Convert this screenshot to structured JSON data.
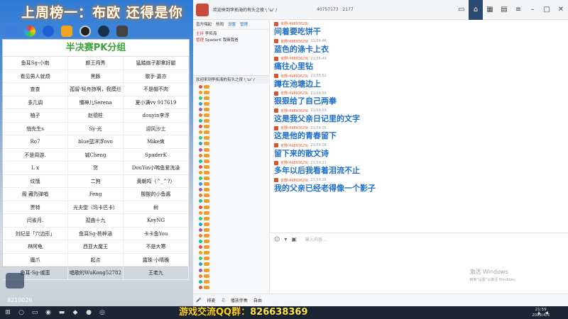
{
  "banner": "上周榜一：布欧 还得是你",
  "bracket": {
    "title": "半决赛PK分组",
    "rows": [
      [
        "鱼耳Sg-小南",
        "颜王闯秀",
        "猛踏扇子那拿好腿"
      ],
      [
        "看见男人就烦",
        "黑豚",
        "歌手-嘉亦"
      ],
      [
        "查查",
        "孤留-轻舟掠啊，我摸烂",
        "不是帽不肉"
      ],
      [
        "多几调",
        "懵神儿Serena",
        "夏小满vv 917619"
      ],
      [
        "柚子",
        "赵德柱",
        "douyin李浮"
      ],
      [
        "悄先生s",
        "Sy-光",
        "迎风沙土"
      ],
      [
        "Ro7",
        "blue蓝洋浮ovo",
        "Mike爽"
      ],
      [
        "不是周游.",
        "铖Cheng",
        "SpaderK"
      ],
      [
        "L x",
        "贷",
        "DouYin小鸭鱼爱洗澡"
      ],
      [
        "纹饿",
        "二狗",
        "黄朝鸡（^_^?）"
      ],
      [
        "阁 藏烈弹唱",
        "Feng",
        "酸酸的小鱼酱"
      ],
      [
        "贾特",
        "光夫堂（玛卡巴卡）",
        "树"
      ],
      [
        "闫雀月.",
        "孤曲十九",
        "KeyNG"
      ],
      [
        "刘纪呈「穴边形」",
        "鱼耳Sg-杨梓涵",
        "卡卡鱼You"
      ],
      [
        "林阿龟",
        "西亚大魔王",
        "不是大寒"
      ],
      [
        "魔爪",
        "起点",
        "露珠-小晴晚"
      ],
      [
        "鱼耳-Sg-戚蛮",
        "唱歌的WuKong52782",
        "王老九"
      ]
    ]
  },
  "watermark": "8210026",
  "app": {
    "room_title": "欢迎来到李拓海的有头之夜 \\ 'ω' /",
    "stat1": "40757173",
    "stat2": "2177",
    "left": {
      "tabs": [
        "直升嗨起",
        "热闹",
        "设置",
        "管理"
      ],
      "manager_label": "管理",
      "manager_name": "SpaderK 我嘛我爸",
      "host_label": "主持",
      "host_name": "李拓海",
      "room_tab": "欢迎来到李拓海的有头之夜 \\ 'ω' /"
    },
    "messages": [
      {
        "nick": "雀野(49893629)",
        "time": "",
        "text": "间着要吃饼干"
      },
      {
        "nick": "雀野(49893629)",
        "time": "21:58:46",
        "text": "蓝色的涤卡上衣"
      },
      {
        "nick": "雀野(49893629)",
        "time": "21:58:49",
        "text": "痛往心里钻"
      },
      {
        "nick": "雀野(49893629)",
        "time": "21:58:52",
        "text": "蹲在池塘边上"
      },
      {
        "nick": "雀野(49893629)",
        "time": "21:58:56",
        "text": "狠狠给了自己两拳"
      },
      {
        "nick": "雀野(49893629)",
        "time": "21:58:59",
        "text": "这是我父亲日记里的文字"
      },
      {
        "nick": "雀野(49893629)",
        "time": "21:59:05",
        "text": "这是他的青春留下"
      },
      {
        "nick": "雀野(49893629)",
        "time": "21:59:08",
        "text": "留下来的散文诗"
      },
      {
        "nick": "雀野(49893629)",
        "time": "21:59:11",
        "text": "多年以后我看着泪流不止"
      },
      {
        "nick": "雀野(49893629)",
        "time": "21:59:18",
        "text": "我的父亲已经老得像一个影子"
      }
    ],
    "composer_placeholder": "输入内容...",
    "activate_title": "激活 Windows",
    "activate_sub": "转到\"设置\"以激活 Windows。",
    "bottom": [
      "排麦",
      "播放伴奏",
      "自由"
    ]
  },
  "taskbar": {
    "qq_label": "游戏交流QQ群：",
    "qq_number": "826638369",
    "time": "21:59",
    "date": "2022/4/3"
  },
  "colors": {
    "chat_text": "#1e6fc7",
    "nick": "#e05a2b",
    "bracket_title": "#3aa23a"
  }
}
